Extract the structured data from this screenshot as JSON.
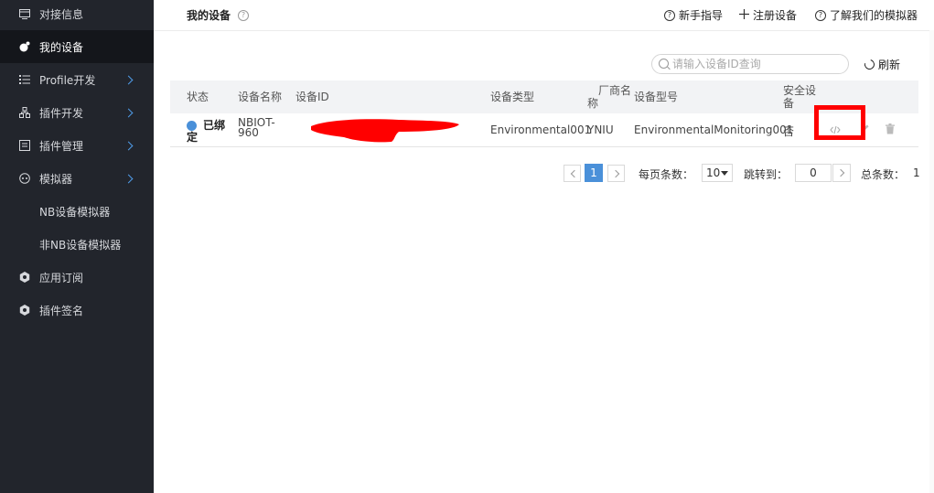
{
  "sidebar": {
    "items": [
      {
        "label": "对接信息",
        "icon": "window-icon"
      },
      {
        "label": "我的设备",
        "icon": "device-icon",
        "active": true
      },
      {
        "label": "Profile开发",
        "icon": "list-icon",
        "expandable": true
      },
      {
        "label": "插件开发",
        "icon": "plugin-icon",
        "expandable": true
      },
      {
        "label": "插件管理",
        "icon": "panel-icon",
        "expandable": true
      },
      {
        "label": "模拟器",
        "icon": "simulator-icon",
        "expandable": true
      },
      {
        "label": "NB设备模拟器"
      },
      {
        "label": "非NB设备模拟器"
      },
      {
        "label": "应用订阅",
        "icon": "subscribe-icon"
      },
      {
        "label": "插件签名",
        "icon": "signature-icon"
      }
    ]
  },
  "header": {
    "title": "我的设备",
    "help_glyph": "?",
    "links": {
      "guide": "新手指导",
      "register": "注册设备",
      "simulator_info": "了解我们的模拟器"
    }
  },
  "toolbar": {
    "search_placeholder": "请输入设备ID查询",
    "refresh_label": "刷新"
  },
  "table": {
    "headers": {
      "status": "状态",
      "name": "设备名称",
      "id": "设备ID",
      "type": "设备类型",
      "vendor_top": "厂商名",
      "vendor_bottom": "称",
      "model": "设备型号",
      "secure_top": "安全设",
      "secure_bottom": "备"
    },
    "rows": [
      {
        "status_top": "已绑",
        "status_bottom": "定",
        "name_top": "NBIOT-",
        "name_bottom": "960",
        "type": "Environmental001",
        "vendor": "YNIU",
        "model": "EnvironmentalMonitoring001",
        "secure": "否"
      }
    ]
  },
  "pagination": {
    "current_page": "1",
    "page_size_label": "每页条数：",
    "page_size": "10",
    "jump_label": "跳转到：",
    "jump_value": "0",
    "total_label": "总条数：",
    "total": "1"
  },
  "colors": {
    "sidebar_bg": "#22252c",
    "sidebar_active": "#14161b",
    "accent": "#4a90d9",
    "highlight": "#ff0000",
    "redaction": "#ff0000"
  }
}
